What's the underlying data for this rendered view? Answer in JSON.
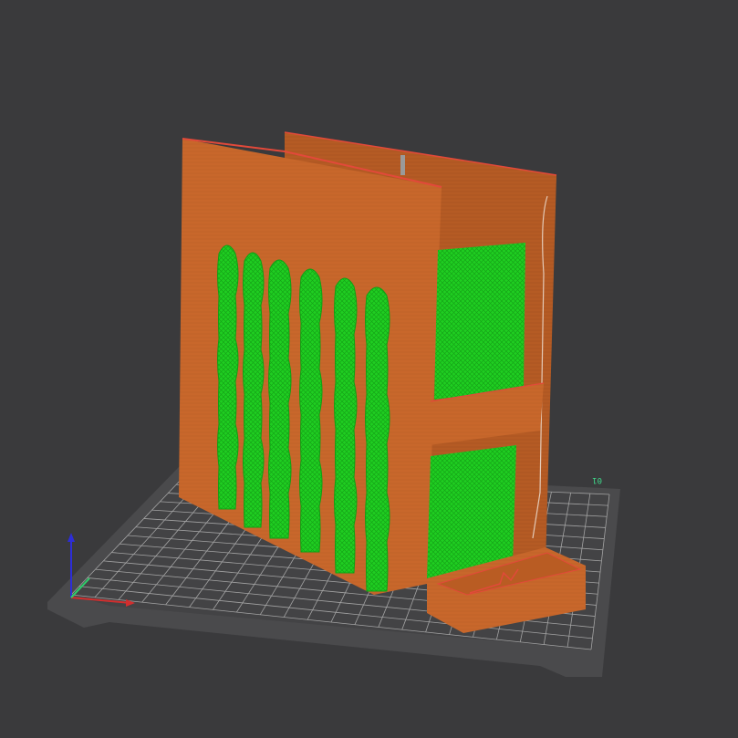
{
  "viewport": {
    "background": "#3a3a3c"
  },
  "build_plate": {
    "label": "01",
    "plate_color": "#4a4a4c",
    "grid_color": "#b4b4b4",
    "label_color": "#3fd68a"
  },
  "model": {
    "wall_color": "#c8672b",
    "wall_shade": "#a9521f",
    "edge_color": "#e2493a",
    "infill_color": "#1fce21",
    "infill_dark": "#0fa014"
  },
  "axes": {
    "x_color": "#d22e2e",
    "y_color": "#2ecc6a",
    "z_color": "#2d2dd8"
  }
}
